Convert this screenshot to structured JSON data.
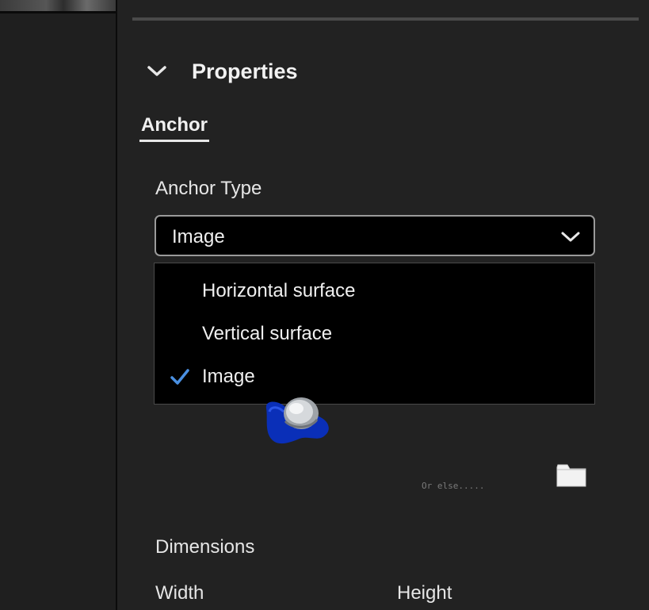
{
  "properties": {
    "section_title": "Properties",
    "tab_label": "Anchor",
    "anchor_type_label": "Anchor Type",
    "anchor_type_value": "Image",
    "anchor_type_options": [
      {
        "label": "Horizontal surface",
        "selected": false
      },
      {
        "label": "Vertical surface",
        "selected": false
      },
      {
        "label": "Image",
        "selected": true
      }
    ],
    "image_hint": "Or else.....",
    "dimensions_label": "Dimensions",
    "width_label": "Width",
    "height_label": "Height"
  },
  "icons": {
    "section_chevron": "chevron-down-icon",
    "select_chevron": "chevron-down-icon",
    "selected_check": "checkmark-icon",
    "browse": "folder-icon"
  },
  "colors": {
    "background": "#222222",
    "accent_check": "#4a90e2",
    "marker_blue": "#0a2fb8"
  }
}
